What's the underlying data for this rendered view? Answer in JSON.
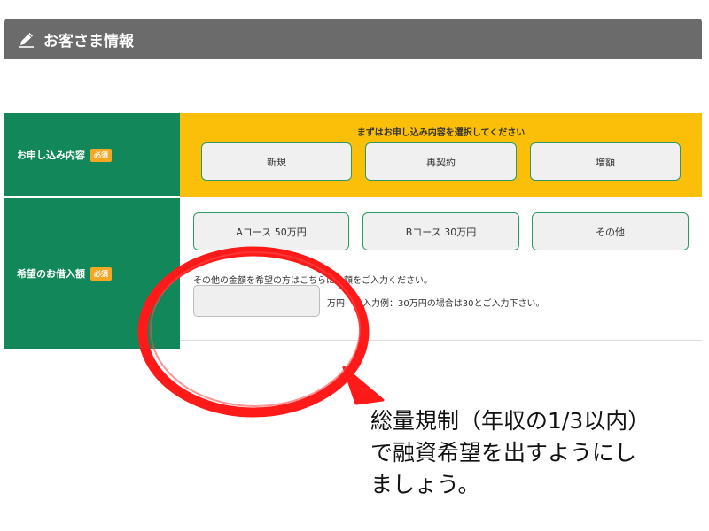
{
  "header": {
    "title": "お客さま情報"
  },
  "form": {
    "application_type": {
      "label": "お申し込み内容",
      "required_badge": "必須",
      "instruction": "まずはお申し込み内容を選択してください",
      "options": [
        "新規",
        "再契約",
        "増額"
      ]
    },
    "desired_amount": {
      "label": "希望のお借入額",
      "required_badge": "必須",
      "options": [
        "Aコース 50万円",
        "Bコース 30万円",
        "その他"
      ],
      "other_prompt": "その他の金額を希望の方はこちらに金額をご入力ください。",
      "input_value": "",
      "unit": "万円",
      "example": "入力例：30万円の場合は30とご入力下さい。"
    }
  },
  "annotation": {
    "callout": "総量規制（年収の1/3以内）\nで融資希望を出すようにし\nましょう。",
    "color": "#ff0000"
  },
  "colors": {
    "header_bg": "#6b6b6b",
    "label_bg": "#12885a",
    "selection_bg": "#fbbf0a",
    "badge": "#f5a623",
    "button_border": "#2e9a63"
  }
}
